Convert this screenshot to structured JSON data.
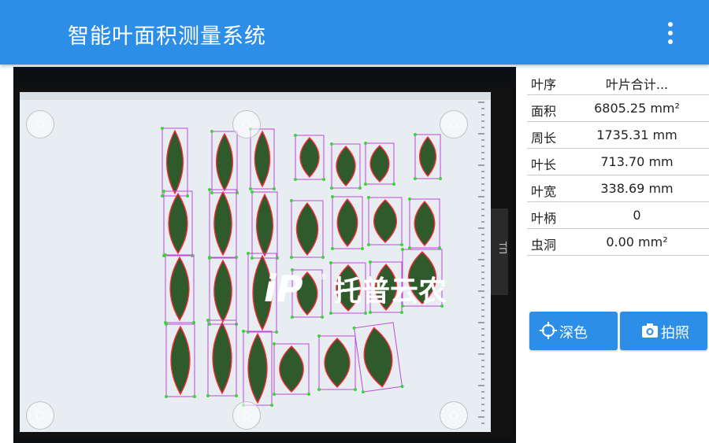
{
  "appbar": {
    "title": "智能叶面积测量系统",
    "menu_icon": "more-vert-icon"
  },
  "preview": {
    "watermark_text": "托普云农",
    "watermark_mark": "iP"
  },
  "results": [
    {
      "label": "叶序",
      "value": "叶片合计..."
    },
    {
      "label": "面积",
      "value": "6805.25 mm²"
    },
    {
      "label": "周长",
      "value": "1735.31 mm"
    },
    {
      "label": "叶长",
      "value": "713.70 mm"
    },
    {
      "label": "叶宽",
      "value": "338.69 mm"
    },
    {
      "label": "叶柄",
      "value": "0"
    },
    {
      "label": "虫洞",
      "value": "0.00 mm²"
    }
  ],
  "buttons": {
    "dark_label": "深色",
    "dark_icon": "crosshair-icon",
    "photo_label": "拍照",
    "photo_icon": "camera-icon"
  },
  "colors": {
    "accent": "#2d8ee8",
    "leaf": "#2f5a2c",
    "contour": "#ff2a3a",
    "box": "#c048e0"
  }
}
